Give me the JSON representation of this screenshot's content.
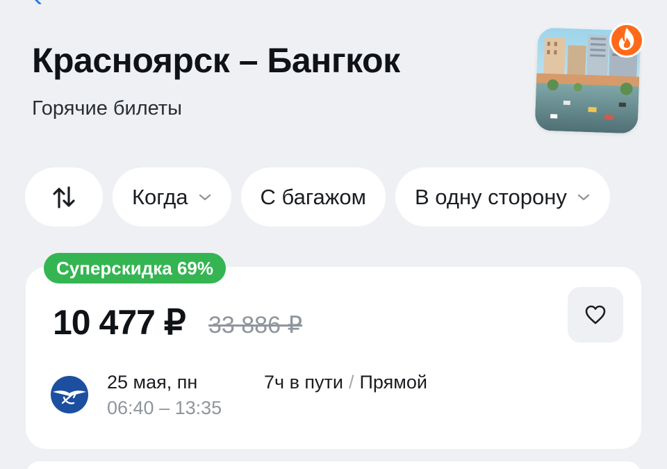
{
  "header": {
    "title": "Красноярск – Бангкок",
    "subtitle": "Горячие билеты"
  },
  "icons": {
    "back": "chevron-left-icon",
    "hero": "city-photo",
    "badge": "fire-icon",
    "swap": "swap-arrows-icon",
    "dropdown": "chevron-down-icon",
    "favorite": "heart-icon",
    "airline": "aeroflot-logo"
  },
  "filters": {
    "when": "Когда",
    "baggage": "С багажом",
    "direction": "В одну сторону"
  },
  "ticket": {
    "discount": "Суперскидка 69%",
    "price": "10 477 ₽",
    "old_price": "33 886 ₽",
    "date": "25 мая, пн",
    "times": "06:40 – 13:35",
    "duration": "7ч в пути",
    "separator": "/",
    "transfer": "Прямой"
  },
  "colors": {
    "background": "#eef0f3",
    "card": "#ffffff",
    "discount_green": "#34b552",
    "fire_orange": "#ff6a1a",
    "airline_blue": "#1c4fa0",
    "back_blue": "#1f7bf2"
  }
}
